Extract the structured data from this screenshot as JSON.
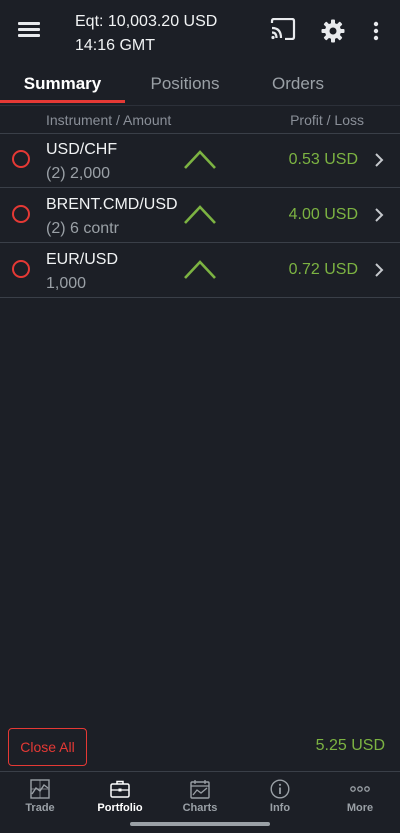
{
  "header": {
    "equity": "Eqt: 10,003.20 USD",
    "time": "14:16 GMT",
    "icons": [
      "menu-icon",
      "cast-icon",
      "gear-icon",
      "more-vert-icon"
    ]
  },
  "tabs": [
    {
      "label": "Summary",
      "active": true
    },
    {
      "label": "Positions",
      "active": false
    },
    {
      "label": "Orders",
      "active": false
    }
  ],
  "columns": {
    "instrument": "Instrument / Amount",
    "pl": "Profit / Loss"
  },
  "rows": [
    {
      "instrument": "USD/CHF",
      "amount": "(2) 2,000",
      "pl": "0.53 USD",
      "trend": "up"
    },
    {
      "instrument": "BRENT.CMD/USD",
      "amount": "(2) 6 contr",
      "pl": "4.00 USD",
      "trend": "up"
    },
    {
      "instrument": "EUR/USD",
      "amount": "1,000",
      "pl": "0.72 USD",
      "trend": "up"
    }
  ],
  "footer": {
    "close_all": "Close All",
    "total": "5.25 USD"
  },
  "nav": [
    {
      "label": "Trade",
      "icon": "trade-chart-icon",
      "active": false
    },
    {
      "label": "Portfolio",
      "icon": "briefcase-icon",
      "active": true
    },
    {
      "label": "Charts",
      "icon": "calendar-chart-icon",
      "active": false
    },
    {
      "label": "Info",
      "icon": "info-icon",
      "active": false
    },
    {
      "label": "More",
      "icon": "more-horiz-icon",
      "active": false
    }
  ],
  "colors": {
    "background": "#1c1f26",
    "accent_red": "#e53935",
    "profit_green": "#7cb342"
  }
}
